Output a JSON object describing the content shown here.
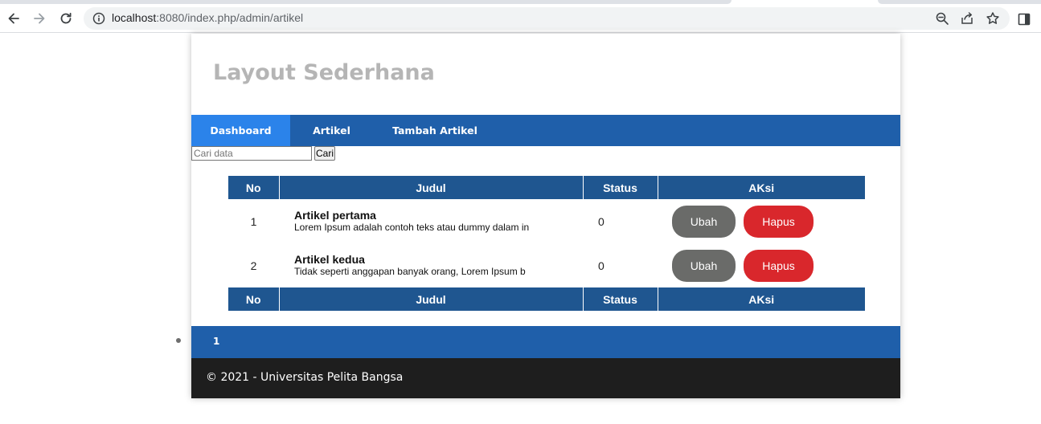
{
  "browser": {
    "url_host": "localhost",
    "url_path": ":8080/index.php/admin/artikel",
    "icons": [
      "back-arrow-icon",
      "forward-arrow-icon",
      "reload-icon",
      "info-icon",
      "zoom-out-icon",
      "share-icon",
      "bookmark-star-icon",
      "side-panel-icon"
    ]
  },
  "header": {
    "title": "Layout Sederhana"
  },
  "nav": {
    "items": [
      {
        "label": "Dashboard",
        "active": true
      },
      {
        "label": "Artikel",
        "active": false
      },
      {
        "label": "Tambah Artikel",
        "active": false
      }
    ]
  },
  "search": {
    "placeholder": "Cari data",
    "button_label": "Cari"
  },
  "table": {
    "headers": [
      "No",
      "Judul",
      "Status",
      "AKsi"
    ],
    "rows": [
      {
        "no": "1",
        "title": "Artikel pertama",
        "excerpt": "Lorem Ipsum adalah contoh teks atau dummy dalam in",
        "status": "0",
        "edit_label": "Ubah",
        "delete_label": "Hapus"
      },
      {
        "no": "2",
        "title": "Artikel kedua",
        "excerpt": "Tidak seperti anggapan banyak orang, Lorem Ipsum b",
        "status": "0",
        "edit_label": "Ubah",
        "delete_label": "Hapus"
      }
    ],
    "footer_headers": [
      "No",
      "Judul",
      "Status",
      "AKsi"
    ]
  },
  "pagination": {
    "page": "1"
  },
  "footer": {
    "text": "© 2021 - Universitas Pelita Bangsa"
  },
  "colors": {
    "nav_bg": "#1f5faa",
    "nav_active": "#2b83ea",
    "table_header": "#1f5690",
    "btn_edit": "#6a6b69",
    "btn_delete": "#d9272c",
    "footer_bg": "#1e1e1e",
    "title_color": "#b5b5b5"
  }
}
